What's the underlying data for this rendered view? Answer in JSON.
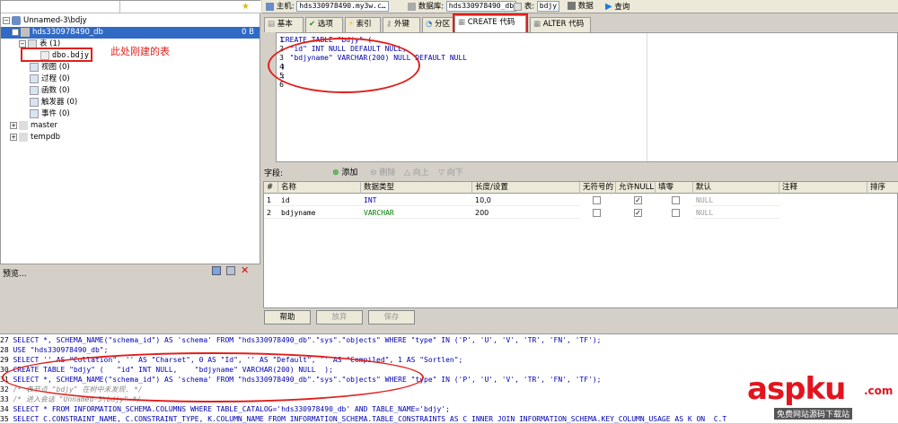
{
  "tree": {
    "root": "Unnamed-3\\bdjy",
    "db": "hds330978490_db",
    "db_size": "0 B",
    "tables_label": "表 (1)",
    "table_item": "dbo.bdjy",
    "annotation": "此处刚建的表",
    "nodes": [
      {
        "label": "视图 (0)",
        "icon": "view-icon"
      },
      {
        "label": "过程 (0)",
        "icon": "procedure-icon"
      },
      {
        "label": "函数 (0)",
        "icon": "function-icon"
      },
      {
        "label": "触发器 (0)",
        "icon": "trigger-icon"
      },
      {
        "label": "事件 (0)",
        "icon": "event-icon"
      }
    ],
    "other_dbs": [
      "master",
      "tempdb"
    ]
  },
  "preview": {
    "label": "预览..."
  },
  "topbar": {
    "host_label": "主机:",
    "host_value": "hds330978490.my3w.c…",
    "db_label": "数据库:",
    "db_value": "hds330978490_db",
    "table_label": "表:",
    "table_value": "bdjy",
    "data_label": "数据",
    "query_label": "查询"
  },
  "tabs": [
    "基本",
    "选项",
    "索引",
    "外键",
    "分区",
    "CREATE 代码",
    "ALTER 代码"
  ],
  "editor": {
    "line_numbers": [
      "1",
      "2",
      "3",
      "4",
      "5",
      "6"
    ],
    "lines": [
      "CREATE TABLE \"bdjy\" (",
      "  \"id\" INT NULL DEFAULT NULL,",
      "  \"bdjyname\" VARCHAR(200) NULL DEFAULT NULL",
      ")",
      ";",
      ""
    ]
  },
  "fields": {
    "label": "字段:",
    "add": "添加",
    "delete": "删除",
    "up": "向上",
    "down": "向下"
  },
  "grid": {
    "headers": [
      "#",
      "名称",
      "数据类型",
      "长度/设置",
      "无符号的",
      "允许NULL",
      "填零",
      "默认",
      "注释",
      "排序"
    ],
    "rows": [
      {
        "num": "1",
        "name": "id",
        "type": "INT",
        "length": "10,0",
        "unsigned": false,
        "allow_null": true,
        "zerofill": false,
        "default": "NULL"
      },
      {
        "num": "2",
        "name": "bdjyname",
        "type": "VARCHAR",
        "length": "200",
        "unsigned": false,
        "allow_null": true,
        "zerofill": false,
        "default": "NULL"
      }
    ]
  },
  "buttons": {
    "help": "帮助",
    "discard": "放弃",
    "save": "保存"
  },
  "log": {
    "lines": [
      {
        "n": "27",
        "text": "SELECT *, SCHEMA_NAME(\"schema_id\") AS 'schema' FROM \"hds330978490_db\".\"sys\".\"objects\" WHERE \"type\" IN ('P', 'U', 'V', 'TR', 'FN', 'TF');"
      },
      {
        "n": "28",
        "text": "USE \"hds330978490_db\";"
      },
      {
        "n": "29",
        "text": "SELECT '' AS \"Collation\", '' AS \"Charset\", 0 AS \"Id\", '' AS \"Default\", '' AS \"Compiled\", 1 AS \"Sortlen\";"
      },
      {
        "n": "30",
        "text": "CREATE TABLE \"bdjy\" (   \"id\" INT NULL,    \"bdjyname\" VARCHAR(200) NULL  );"
      },
      {
        "n": "31",
        "text": "SELECT *, SCHEMA_NAME(\"schema_id\") AS 'schema' FROM \"hds330978490_db\".\"sys\".\"objects\" WHERE \"type\" IN ('P', 'U', 'V', 'TR', 'FN', 'TF');"
      },
      {
        "n": "32",
        "text": "/* 表节点 \"bdjy\" 在树中未发现. */"
      },
      {
        "n": "33",
        "text": "/* 进入会话 \"Unnamed-3\\bdjy\" */"
      },
      {
        "n": "34",
        "text": "SELECT * FROM INFORMATION_SCHEMA.COLUMNS WHERE TABLE_CATALOG='hds330978490_db' AND TABLE_NAME='bdjy';"
      },
      {
        "n": "35",
        "text": "SELECT C.CONSTRAINT_NAME, C.CONSTRAINT_TYPE, K.COLUMN_NAME FROM INFORMATION_SCHEMA.TABLE_CONSTRAINTS AS C INNER JOIN INFORMATION_SCHEMA.KEY_COLUMN_USAGE AS K ON  C.T"
      }
    ]
  },
  "watermark": {
    "brand": "aspku",
    "suffix": ".com",
    "sub": "免费网站源码下载站"
  },
  "colors": {
    "annotation_red": "#e0201c",
    "keyword_blue": "#0000b0",
    "brand_red": "#e3141e"
  }
}
